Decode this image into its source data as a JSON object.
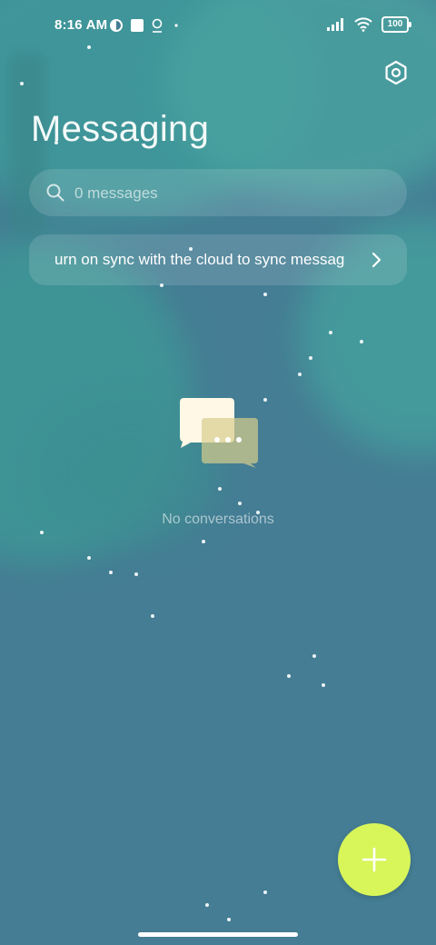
{
  "status_bar": {
    "time": "8:16 AM",
    "battery": "100",
    "icons": [
      "app-notification-icon",
      "square-notification-icon",
      "location-icon",
      "dot-icon",
      "signal-icon",
      "wifi-icon",
      "battery-icon"
    ]
  },
  "header": {
    "title": "Messaging",
    "settings_icon": "settings-hexagon-icon"
  },
  "search": {
    "placeholder": "0 messages",
    "icon": "search-icon"
  },
  "sync_banner": {
    "text": "urn on sync with the cloud to sync messag",
    "icon": "chevron-right-icon"
  },
  "empty_state": {
    "icon": "chat-bubbles-icon",
    "text": "No conversations"
  },
  "fab": {
    "icon": "plus-icon",
    "color": "#d8f55a"
  },
  "colors": {
    "background": "#447d94",
    "teal_overlay": "#3f9a9a",
    "accent": "#d8f55a"
  }
}
